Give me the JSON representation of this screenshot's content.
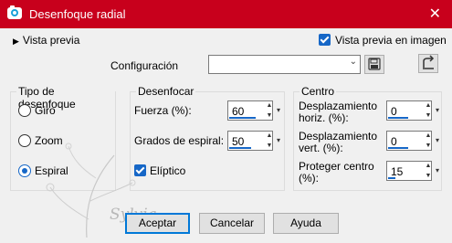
{
  "window": {
    "title": "Desenfoque radial",
    "close_glyph": "✕"
  },
  "top": {
    "preview_toggle": "Vista previa",
    "preview_in_image": "Vista previa en imagen",
    "preview_in_image_checked": true,
    "config_label": "Configuración",
    "config_value": ""
  },
  "blur_type": {
    "title": "Tipo de desenfoque",
    "options": [
      "Giro",
      "Zoom",
      "Espiral"
    ],
    "selected": "Espiral"
  },
  "blur": {
    "title": "Desenfocar",
    "strength_label": "Fuerza (%):",
    "strength_value": "60",
    "spiral_label": "Grados de espiral:",
    "spiral_value": "50",
    "elliptic_label": "Elíptico",
    "elliptic_checked": true
  },
  "center": {
    "title": "Centro",
    "h_offset_label_1": "Desplazamiento",
    "h_offset_label_2": "horiz. (%):",
    "h_offset_value": "0",
    "v_offset_label_1": "Desplazamiento",
    "v_offset_label_2": "vert. (%):",
    "v_offset_value": "0",
    "protect_label_1": "Proteger centro",
    "protect_label_2": "(%):",
    "protect_value": "15"
  },
  "buttons": {
    "ok": "Aceptar",
    "cancel": "Cancelar",
    "help": "Ayuda"
  },
  "watermark": "Sylvia",
  "colors": {
    "titlebar": "#c8001c",
    "accent": "#1667c7"
  }
}
